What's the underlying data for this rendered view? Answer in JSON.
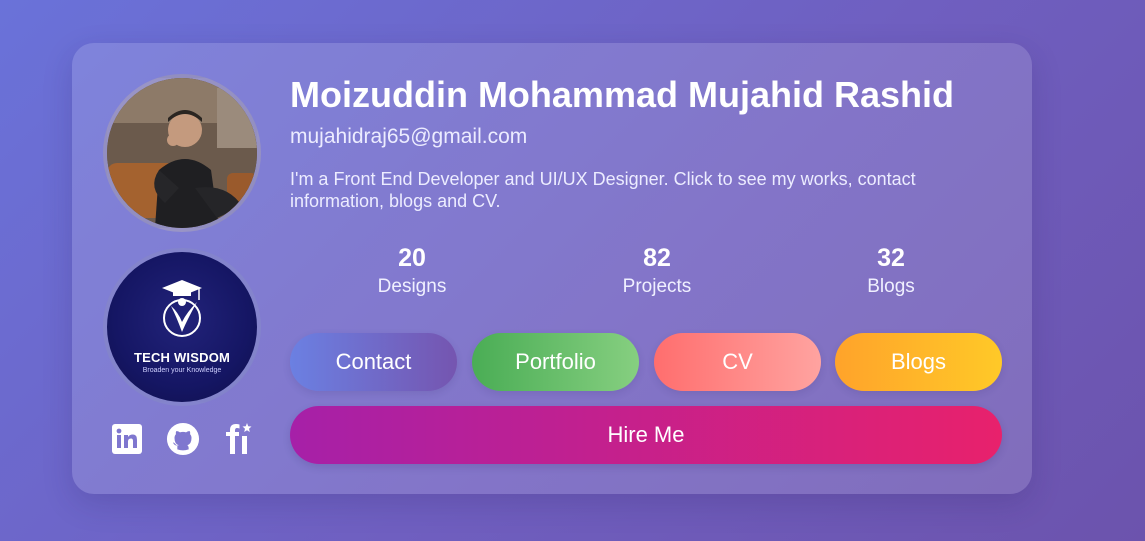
{
  "profile": {
    "name": "Moizuddin Mohammad Mujahid Rashid",
    "email": "mujahidraj65@gmail.com",
    "bio": "I'm a Front End Developer and UI/UX Designer. Click to see my works, contact information, blogs and CV."
  },
  "logo": {
    "title": "TECH WISDOM",
    "tagline": "Broaden your Knowledge"
  },
  "stats": [
    {
      "value": "20",
      "label": "Designs"
    },
    {
      "value": "82",
      "label": "Projects"
    },
    {
      "value": "32",
      "label": "Blogs"
    }
  ],
  "buttons": {
    "contact": "Contact",
    "portfolio": "Portfolio",
    "cv": "CV",
    "blogs": "Blogs",
    "hire": "Hire Me"
  },
  "socials": [
    {
      "icon": "linkedin-icon"
    },
    {
      "icon": "github-icon"
    },
    {
      "icon": "figma-style-fi-icon"
    }
  ],
  "colors": {
    "background_start": "#6a72d9",
    "background_end": "#6c53ad",
    "contact_gradient": [
      "#6b80e2",
      "#7555b0"
    ],
    "portfolio_gradient": [
      "#4aad55",
      "#86cf80"
    ],
    "cv_gradient": [
      "#ff6e6e",
      "#ffa3a0"
    ],
    "blogs_gradient": [
      "#ffa32a",
      "#ffc928"
    ],
    "hire_gradient": [
      "#a620a8",
      "#e8216c"
    ]
  }
}
